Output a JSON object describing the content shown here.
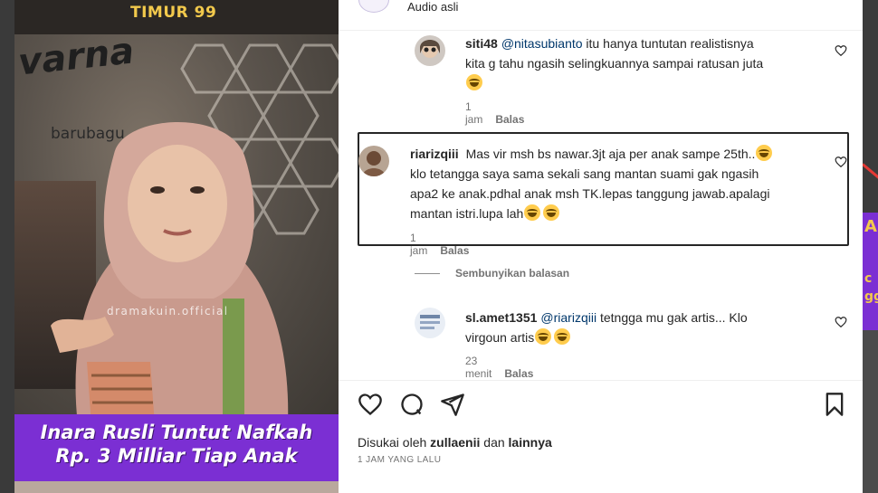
{
  "media": {
    "top_label": "TIMUR 99",
    "store_sign": "varna",
    "store_sub": "barubagu",
    "watermark": "dramakuin.official",
    "caption_line1": "Inara Rusli Tuntut Nafkah",
    "caption_line2": "Rp. 3 Milliar Tiap Anak"
  },
  "header": {
    "audio_label": "Audio asli"
  },
  "comments": [
    {
      "username": "siti48",
      "mention": "@nitasubianto",
      "text": "itu hanya tuntutan realistisnya",
      "line2": "kita g tahu ngasih selingkuannya sampai ratusan juta",
      "time": "1 jam",
      "reply": "Balas"
    },
    {
      "username": "riarizqiii",
      "text": "Mas vir msh bs nawar.3jt aja per anak sampe 25th..",
      "line2": "klo tetangga saya sama sekali sang mantan suami gak ngasih",
      "line3": "apa2 ke anak.pdhal anak msh TK.lepas tanggung jawab.apalagi",
      "line4": "mantan istri.lupa lah",
      "time": "1 jam",
      "reply": "Balas"
    },
    {
      "username": "sl.amet1351",
      "mention": "@riarizqiii",
      "text": "tetngga mu gak artis... Klo",
      "line2": "virgoun artis",
      "time": "23 menit",
      "reply": "Balas"
    }
  ],
  "hide_replies": "Sembunyikan balasan",
  "actions": {
    "liked_prefix": "Disukai oleh",
    "liked_user": "zullaenii",
    "liked_and": "dan",
    "liked_others": "lainnya",
    "time_ago": "1 JAM YANG LALU"
  },
  "right_strip": {
    "letter_a": "A",
    "letter_c": "c",
    "letter_g": "gg"
  },
  "colors": {
    "caption_band": "#7b2fd3",
    "mention": "#00376b",
    "meta": "#737373",
    "accent_yellow": "#f2c94c"
  }
}
